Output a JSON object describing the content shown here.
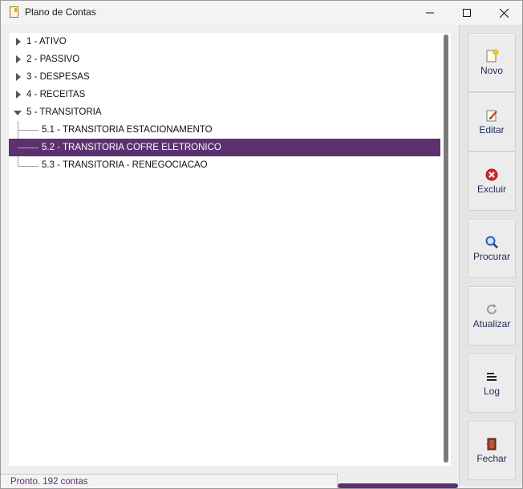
{
  "window": {
    "title": "Plano de Contas"
  },
  "tree": {
    "items": [
      {
        "label": "1 - ATIVO",
        "level": 0,
        "expanded": false,
        "selected": false
      },
      {
        "label": "2 - PASSIVO",
        "level": 0,
        "expanded": false,
        "selected": false
      },
      {
        "label": "3 - DESPESAS",
        "level": 0,
        "expanded": false,
        "selected": false
      },
      {
        "label": "4 - RECEITAS",
        "level": 0,
        "expanded": false,
        "selected": false
      },
      {
        "label": "5 - TRANSITORIA",
        "level": 0,
        "expanded": true,
        "selected": false
      },
      {
        "label": "5.1 - TRANSITORIA ESTACIONAMENTO",
        "level": 1,
        "expanded": false,
        "selected": false
      },
      {
        "label": "5.2 - TRANSITORIA COFRE ELETRONICO",
        "level": 1,
        "expanded": false,
        "selected": true
      },
      {
        "label": "5.3 - TRANSITORIA - RENEGOCIACAO",
        "level": 1,
        "expanded": false,
        "selected": false
      }
    ]
  },
  "toolbar": {
    "novo": "Novo",
    "editar": "Editar",
    "excluir": "Excluir",
    "procurar": "Procurar",
    "atualizar": "Atualizar",
    "log": "Log",
    "fechar": "Fechar"
  },
  "status": {
    "text": "Pronto. 192 contas"
  },
  "colors": {
    "selection": "#5b3170",
    "status_text": "#5b3170",
    "button_label": "#1f2a55"
  }
}
